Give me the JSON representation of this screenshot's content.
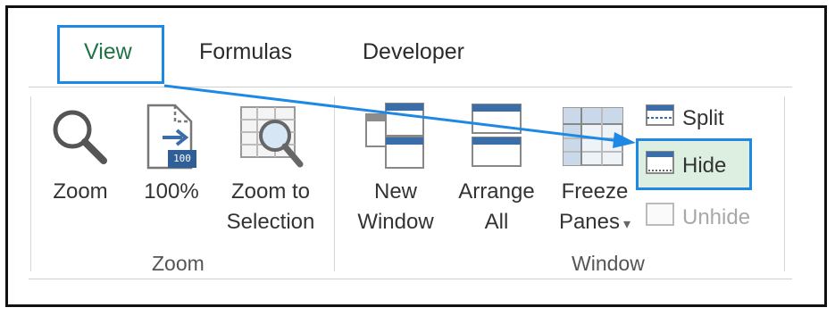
{
  "tabs": [
    {
      "label": "View",
      "active": true
    },
    {
      "label": "Formulas",
      "active": false
    },
    {
      "label": "Developer",
      "active": false
    }
  ],
  "zoom_group": {
    "label": "Zoom",
    "commands": [
      {
        "label": "Zoom",
        "icon": "magnifier-icon"
      },
      {
        "label": "100%",
        "icon": "zoom-100-icon",
        "badge": "100"
      },
      {
        "label_line1": "Zoom to",
        "label_line2": "Selection",
        "icon": "zoom-to-selection-icon"
      }
    ]
  },
  "window_group": {
    "label": "Window",
    "commands": [
      {
        "label_line1": "New",
        "label_line2": "Window",
        "icon": "new-window-icon"
      },
      {
        "label_line1": "Arrange",
        "label_line2": "All",
        "icon": "arrange-all-icon"
      },
      {
        "label_line1": "Freeze",
        "label_line2": "Panes",
        "icon": "freeze-panes-icon",
        "dropdown": "▾"
      }
    ],
    "small_commands": [
      {
        "label": "Split",
        "icon": "split-icon",
        "enabled": true
      },
      {
        "label": "Hide",
        "icon": "hide-icon",
        "enabled": true,
        "highlighted": true
      },
      {
        "label": "Unhide",
        "icon": "unhide-icon",
        "enabled": false
      }
    ]
  },
  "colors": {
    "accent_highlight": "#1e88e5",
    "active_tab": "#217346",
    "hide_background": "#dcefe1",
    "icon_blue": "#3b6ea8"
  }
}
